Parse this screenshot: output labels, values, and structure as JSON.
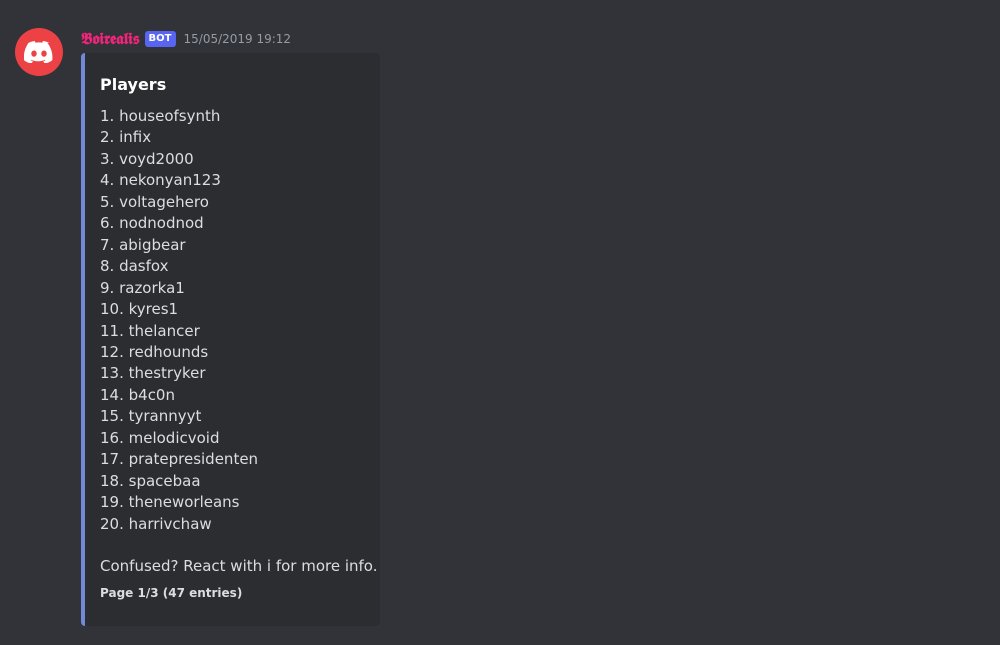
{
  "message": {
    "author": {
      "name": "𝕭𝖔𝖎𝖗𝖊𝖆𝖑𝖎𝖘",
      "badge": "BOT",
      "avatar_icon": "discord-logo-icon",
      "name_color": "#f0247a"
    },
    "timestamp": "15/05/2019 19:12",
    "embed": {
      "accent_color": "#7289da",
      "title": "Players",
      "items": [
        {
          "text": "1. houseofsynth"
        },
        {
          "text": "2. infix"
        },
        {
          "text": "3. voyd2000"
        },
        {
          "text": "4. nekonyan123"
        },
        {
          "text": "5. voltagehero"
        },
        {
          "text": "6. nodnodnod"
        },
        {
          "text": "7. abigbear"
        },
        {
          "text": "8. dasfox"
        },
        {
          "text": "9. razorka1"
        },
        {
          "text": "10. kyres1"
        },
        {
          "text": "11. thelancer"
        },
        {
          "text": "12. redhounds"
        },
        {
          "text": "13. thestryker"
        },
        {
          "text": "14. b4c0n"
        },
        {
          "text": "15. tyrannyyt"
        },
        {
          "text": "16. melodicvoid"
        },
        {
          "text": "17. pratepresidenten"
        },
        {
          "text": "18. spacebaa"
        },
        {
          "text": "19. theneworleans"
        },
        {
          "text": "20. harrivchaw"
        }
      ],
      "description": "Confused? React with i for more info.",
      "footer": "Page 1/3 (47 entries)"
    }
  }
}
